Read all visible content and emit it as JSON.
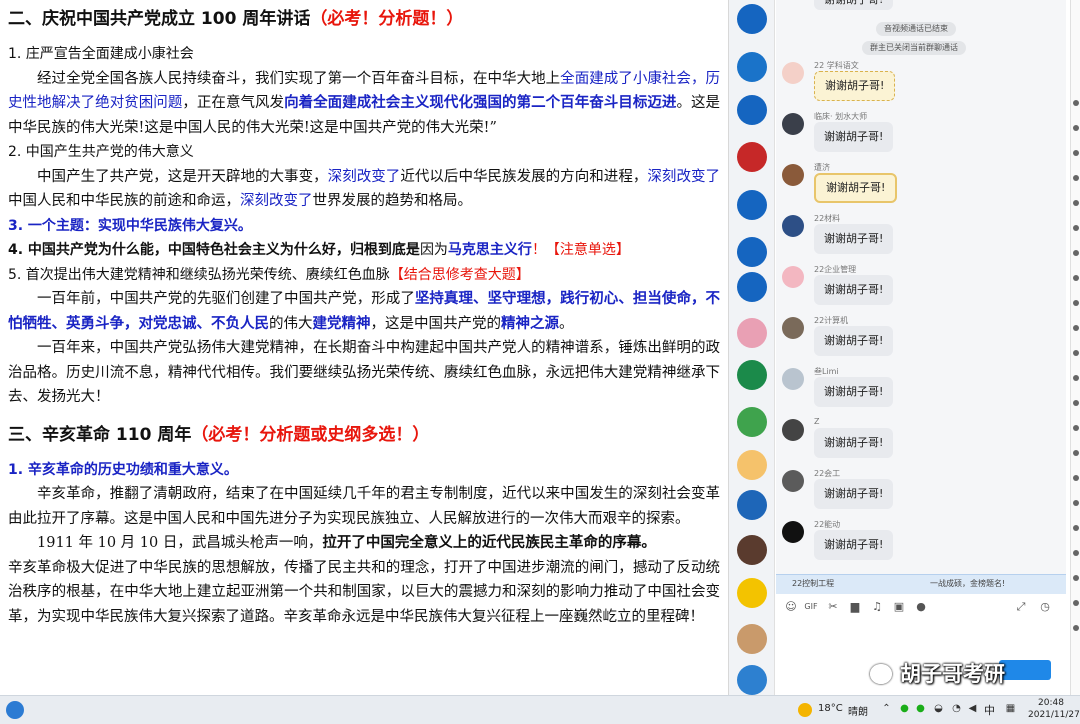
{
  "document": {
    "section2": {
      "heading": "二、庆祝中国共产党成立 100 周年讲话",
      "heading_red": "（必考！分析题！）",
      "item1_title": "1. 庄严宣告全面建成小康社会",
      "p1_a": "经过全党全国各族人民持续奋斗，我们实现了第一个百年奋斗目标，在中华大地上",
      "p1_b": "全面建成了小康社会，历史性地解决了绝对贫困问题",
      "p1_c": "，正在意气风发",
      "p1_d": "向着全面建成社会主义现代化强国的第二个百年奋斗目标迈进",
      "p1_e": "。这是中华民族的伟大光荣!这是中国人民的伟大光荣!这是中国共产党的伟大光荣!”",
      "item2_title": "2. 中国产生共产党的伟大意义",
      "p2_a": "中国产生了共产党，这是开天辟地的大事变，",
      "p2_b": "深刻改变了",
      "p2_c": "近代以后中华民族发展的方向和进程，",
      "p2_d": "深刻改变了",
      "p2_e": "中国人民和中华民族的前途和命运，",
      "p2_f": "深刻改变了",
      "p2_g": "世界发展的趋势和格局。",
      "item3": "3. 一个主题：实现中华民族伟大复兴。",
      "item4_a": "4. 中国共产党为什么能，中国特色社会主义为什么好，",
      "item4_b": "归根到底是",
      "item4_c": "因为",
      "item4_d": "马克思主义行",
      "item4_e": "！【注意单选】",
      "item5_a": "5. 首次提出伟大建党精神和继续弘扬光荣传统、赓续红色血脉",
      "item5_b": "【结合思修考查大题】",
      "p5_a": "一百年前，中国共产党的先驱们创建了中国共产党，形成了",
      "p5_b": "坚持真理、坚守理想，践行初心、担当使命，不怕牺牲、英勇斗争，对党忠诚、不负人民",
      "p5_c": "的伟大",
      "p5_d": "建党精神",
      "p5_e": "，这是中国共产党的",
      "p5_f": "精神之源",
      "p5_g": "。",
      "p6": "一百年来，中国共产党弘扬伟大建党精神，在长期奋斗中构建起中国共产党人的精神谱系，锤炼出鲜明的政治品格。历史川流不息，精神代代相传。我们要继续弘扬光荣传统、赓续红色血脉，永远把伟大建党精神继承下去、发扬光大！"
    },
    "section3": {
      "heading": "三、辛亥革命 110 周年",
      "heading_red": "（必考！分析题或史纲多选！）",
      "item1_title": "1. 辛亥革命的历史功绩和重大意义。",
      "p1": "辛亥革命，推翻了清朝政府，结束了在中国延续几千年的君主专制制度，近代以来中国发生的深刻社会变革由此拉开了序幕。这是中国人民和中国先进分子为实现民族独立、人民解放进行的一次伟大而艰辛的探索。",
      "p2_a": "1911 年 10 月 10 日，武昌城头枪声一响，",
      "p2_b": "拉开了中国完全意义上的近代民族民主革命的序幕。",
      "p2_c": "辛亥革命极大促进了中华民族的思想解放，传播了民主共和的理念，打开了中国进步潮流的闸门，撼动了反动统治秩序的根基，在中华大地上建立起亚洲第一个共和制国家，以巨大的震撼力和深刻的影响力推动了中国社会变革，为实现中华民族伟大复兴探索了道路。辛亥革命永远是中华民族伟大复兴征程上一座巍然屹立的里程碑！"
    }
  },
  "chat": {
    "top_label": "谢谢胡子哥!",
    "system_messages": [
      "音视频通话已结束",
      "群主已关闭当前群聊通话"
    ],
    "messages": [
      {
        "name": "22 学科语文",
        "text": "谢谢胡子哥!",
        "style": "gold-dot",
        "color": "#f4d0c8"
      },
      {
        "name": "临床· 划水大师",
        "text": "谢谢胡子哥!",
        "style": "plain",
        "color": "#3a3f4a"
      },
      {
        "name": "遭济",
        "text": "谢谢胡子哥!",
        "style": "gold",
        "color": "#8a5a3a"
      },
      {
        "name": "22材料",
        "text": "谢谢胡子哥!",
        "style": "plain",
        "color": "#2d4f86"
      },
      {
        "name": "22企业管理",
        "text": "谢谢胡子哥!",
        "style": "plain",
        "color": "#f3b7c1"
      },
      {
        "name": "22计算机",
        "text": "谢谢胡子哥!",
        "style": "plain",
        "color": "#7a6a5a"
      },
      {
        "name": "叁Limi",
        "text": "谢谢胡子哥!",
        "style": "plain",
        "color": "#b9c4cf"
      },
      {
        "name": "Z",
        "text": "谢谢胡子哥!",
        "style": "plain",
        "color": "#444"
      },
      {
        "name": "22会工",
        "text": "谢谢胡子哥!",
        "style": "plain",
        "color": "#5b5b5b"
      },
      {
        "name": "22能动",
        "text": "谢谢胡子哥!",
        "style": "plain",
        "color": "#111"
      }
    ],
    "notice_left": "22控制工程",
    "notice_right": "一战成硕，金榜题名!",
    "toolbar_icons": [
      "emoji-icon",
      "gif-icon",
      "scissors-icon",
      "folder-icon",
      "music-icon",
      "image-icon",
      "mic-icon",
      "expand-icon",
      "history-icon"
    ],
    "toolbar_glyphs": {
      "emoji": "☺",
      "gif": "GIF",
      "scissors": "✂",
      "folder": "▆",
      "music": "♫",
      "image": "▣",
      "mic": "●",
      "expand": "⤢",
      "history": "◷"
    },
    "sidebar_avatar_colors": [
      "#1565c0",
      "#1a73c9",
      "#1565c0",
      "#c62828",
      "#1565c0",
      "#1565c0",
      "#1565c0",
      "#e9a0b4",
      "#1b8a4a",
      "#3fa34d",
      "#f5c26b",
      "#1e66b8",
      "#5a3b2e",
      "#f3c300",
      "#c99a6b",
      "#2d80d0"
    ]
  },
  "watermark": {
    "text": "胡子哥考研"
  },
  "taskbar": {
    "temperature": "18°C",
    "weather": "晴朗",
    "ime": "中",
    "time": "20:48",
    "date": "2021/11/27"
  }
}
